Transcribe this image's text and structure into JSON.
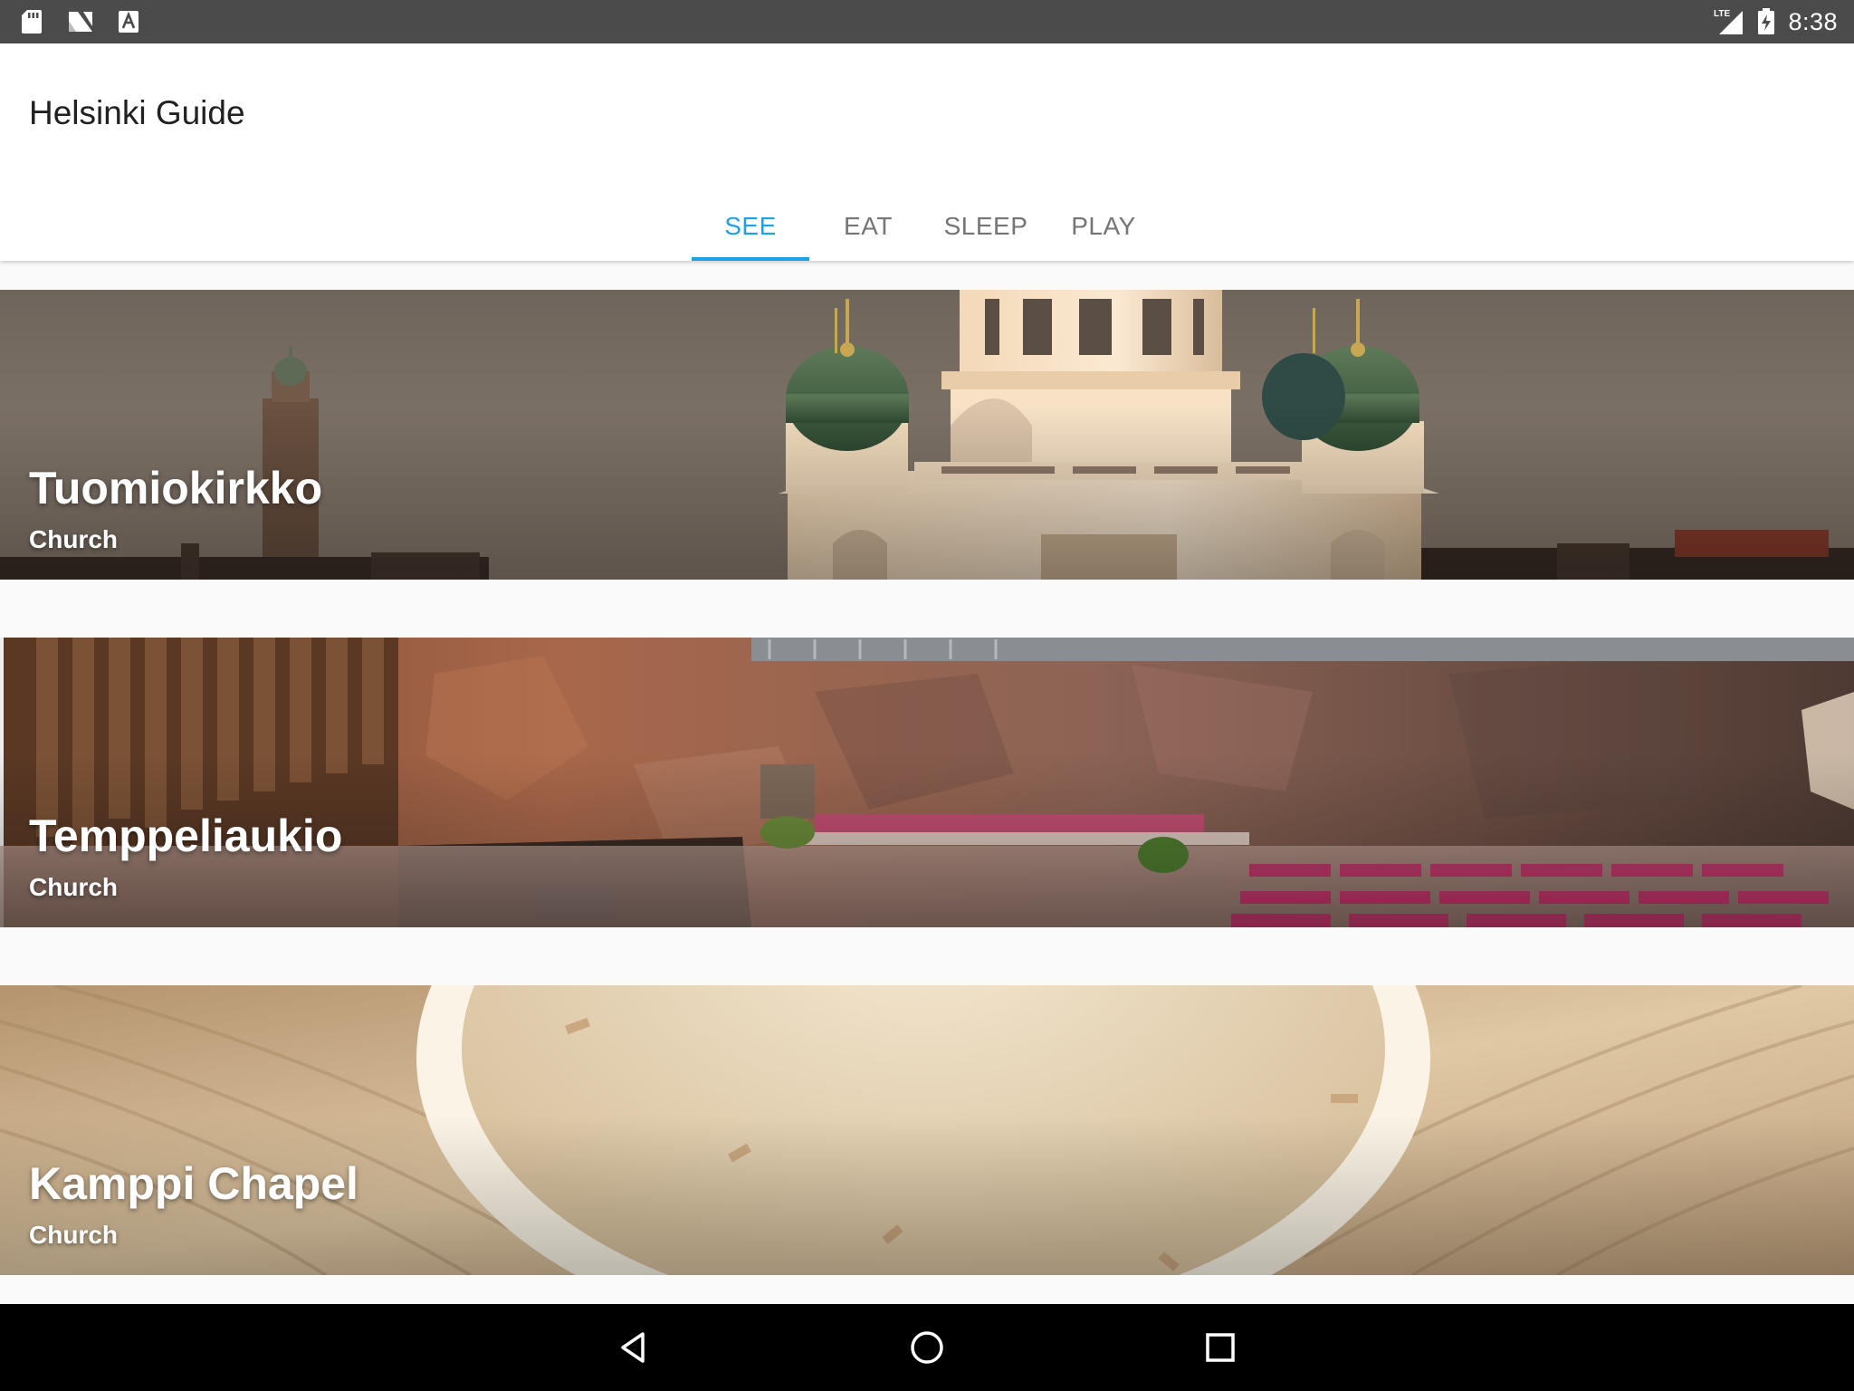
{
  "status_bar": {
    "time": "8:38",
    "left_icons": [
      "sd-card-icon",
      "n-logo-icon",
      "a-badge-icon"
    ],
    "right_icons": [
      "lte-signal-icon",
      "battery-charging-icon"
    ],
    "network_label": "LTE"
  },
  "app": {
    "title": "Helsinki Guide",
    "accent_color": "#1fa1e6"
  },
  "tabs": [
    {
      "label": "SEE",
      "active": true
    },
    {
      "label": "EAT",
      "active": false
    },
    {
      "label": "SLEEP",
      "active": false
    },
    {
      "label": "PLAY",
      "active": false
    }
  ],
  "places": [
    {
      "name": "Tuomiokirkko",
      "category": "Church",
      "image": "cathedral-photo"
    },
    {
      "name": "Temppeliaukio",
      "category": "Church",
      "image": "rock-church-photo"
    },
    {
      "name": "Kamppi Chapel",
      "category": "Church",
      "image": "wooden-chapel-photo"
    }
  ],
  "nav_bar": {
    "buttons": [
      "back-icon",
      "home-icon",
      "recents-icon"
    ]
  }
}
